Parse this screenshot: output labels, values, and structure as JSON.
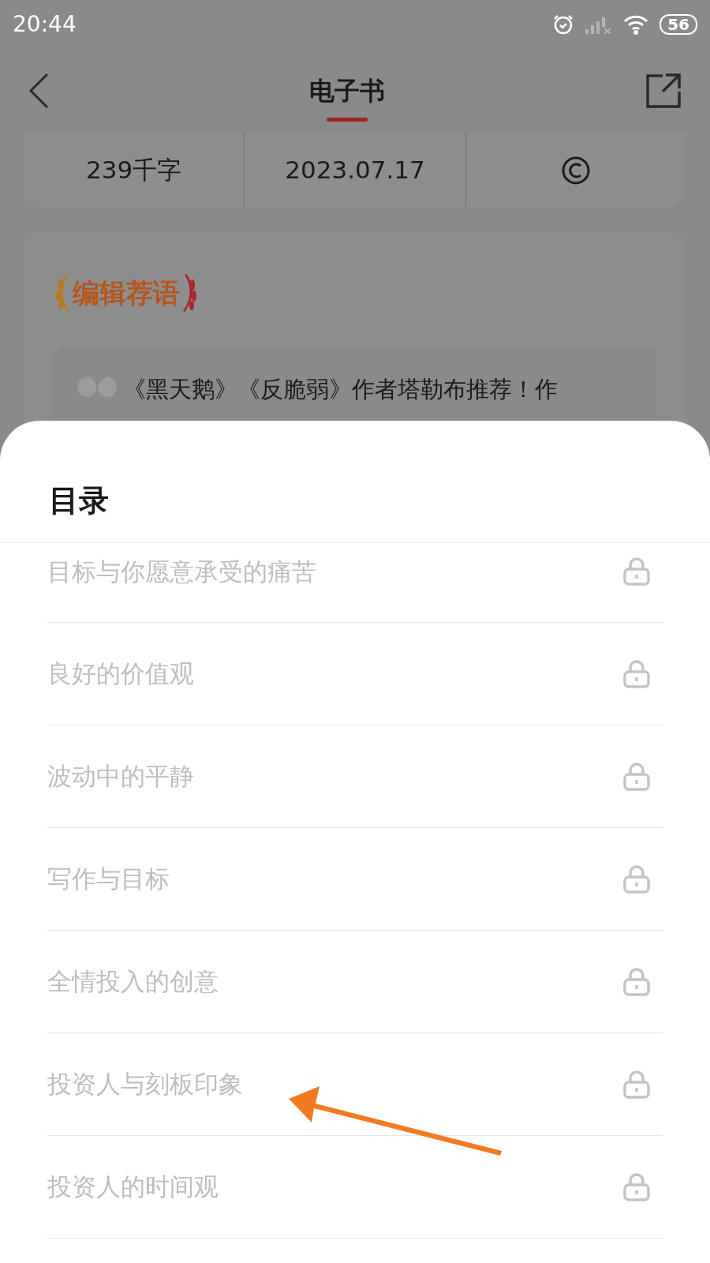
{
  "status_bar": {
    "time": "20:44",
    "battery": "56"
  },
  "header": {
    "title": "电子书",
    "tab_selected": true
  },
  "stats": [
    "239千字",
    "2023.07.17"
  ],
  "editor_pick": {
    "title": "编辑荐语",
    "quote": "《黑天鹅》《反脆弱》作者塔勒布推荐！作"
  },
  "contents_sheet": {
    "title": "目录",
    "chapters": [
      {
        "title": "目标与你愿意承受的痛苦",
        "locked": true
      },
      {
        "title": "良好的价值观",
        "locked": true
      },
      {
        "title": "波动中的平静",
        "locked": true
      },
      {
        "title": "写作与目标",
        "locked": true
      },
      {
        "title": "全情投入的创意",
        "locked": true
      },
      {
        "title": "投资人与刻板印象",
        "locked": true
      },
      {
        "title": "投资人的时间观",
        "locked": true
      }
    ]
  }
}
